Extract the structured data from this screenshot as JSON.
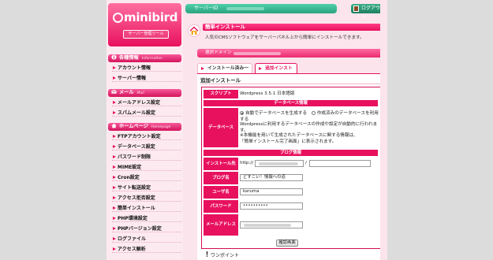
{
  "brand": {
    "logo_text": "minibird",
    "logo_sub": "サーバー管理ツール"
  },
  "top": {
    "server_id_label": "サーバーID",
    "logout_label": "ログアウト"
  },
  "sidebar": {
    "sections": [
      {
        "title": "各種情報",
        "subtitle": "Information",
        "items": [
          "アカウント情報",
          "サーバー情報"
        ]
      },
      {
        "title": "メール",
        "subtitle": "Mail",
        "items": [
          "メールアドレス設定",
          "スパムメール設定"
        ]
      },
      {
        "title": "ホームページ",
        "subtitle": "Homepage",
        "items": [
          "FTPアカウント設定",
          "データベース設定",
          "パスワード制限",
          "MIME設定",
          "Cron設定",
          "サイト転送設定",
          "アクセス拒否設定",
          "簡単インストール",
          "PHP環境設定",
          "PHPバージョン設定",
          "ログファイル",
          "アクセス解析"
        ]
      }
    ]
  },
  "main": {
    "title": "簡単インストール",
    "description": "人気のCMSソフトウェアをサーバーパネル上から簡単にインストールできます。",
    "domain_label": "選択ドメイン",
    "tabs": [
      {
        "label": "インストール済み一覧",
        "active": false
      },
      {
        "label": "追加インストール",
        "active": true
      }
    ],
    "section_heading": "追加インストール",
    "form": {
      "script_label": "スクリプト",
      "script_value": "Wordpress 3.5.1 日本語版",
      "db_band": "データベース情報",
      "db_label": "データベース",
      "db_option_auto": "自動でデータベースを生成する",
      "db_option_manual": "作成済みのデータベースを利用する",
      "db_selected": "auto",
      "db_note_1": "Wordpressに利用するデータベースの作成や設定が自動的に行われます。",
      "db_note_2": "※本機能を用いて生成されたデータベースに関する情報は、",
      "db_note_3": "「簡単インストール完了画面」に表示されます。",
      "blog_band": "ブログ情報",
      "install_label": "インストール先",
      "install_prefix": "http://",
      "install_sep": "/",
      "blog_name_label": "ブログ名",
      "blog_name_value": "どすこい！情報への道",
      "user_label": "ユーザ名",
      "user_value": "karuma",
      "password_label": "パスワード",
      "password_value": "••••••••••",
      "email_label": "メールアドレス",
      "confirm_button": "確認画面"
    },
    "onepoint": "ワンポイント"
  },
  "colors": {
    "accent": "#e8115e",
    "topbar": "#2aa37f",
    "background": "#fbe4ec"
  }
}
